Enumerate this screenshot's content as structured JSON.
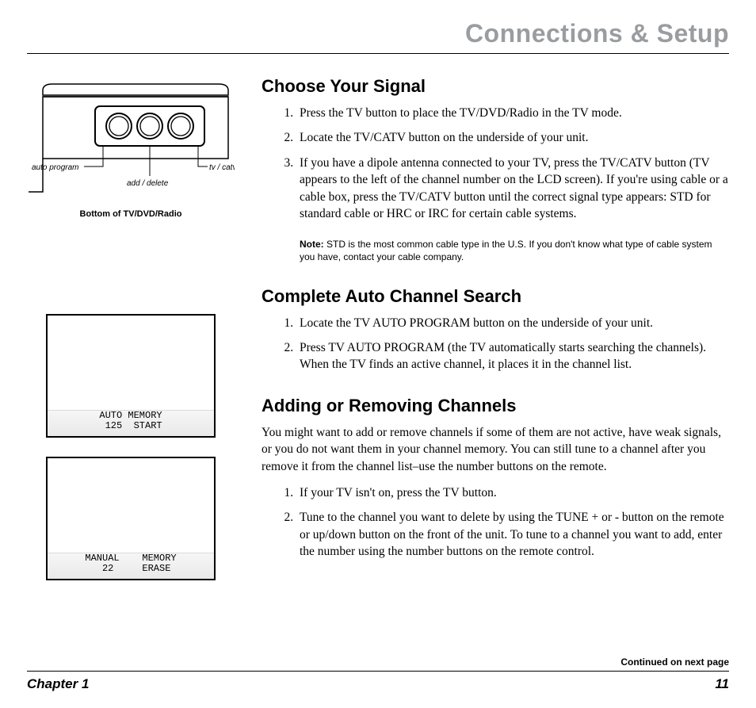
{
  "header": {
    "title": "Connections & Setup"
  },
  "diagram": {
    "label_auto_program": "auto program",
    "label_add_delete": "add / delete",
    "label_tv_catv": "tv / catv",
    "caption": "Bottom of TV/DVD/Radio"
  },
  "screens": {
    "auto": "AUTO MEMORY\n 125  START",
    "manual": "MANUAL    MEMORY\n  22     ERASE"
  },
  "sections": {
    "choose_signal": {
      "title": "Choose Your Signal",
      "steps": [
        "Press the TV button to place the TV/DVD/Radio in the TV mode.",
        "Locate the TV/CATV button on the underside of your unit.",
        "If you have a dipole antenna connected to your TV, press the TV/CATV button (TV appears to the left of the channel number on the LCD screen). If you're using cable or a cable box, press the TV/CATV button until the correct signal type appears: STD for standard cable or HRC or IRC for certain cable systems."
      ],
      "note_label": "Note:",
      "note_text": " STD is the most common cable type in the U.S. If you don't know what type of cable system you have, contact your cable company."
    },
    "auto_search": {
      "title": "Complete Auto Channel Search",
      "steps": [
        "Locate the TV AUTO PROGRAM button on the underside of your unit.",
        "Press TV AUTO PROGRAM (the TV automatically starts searching the channels). When the TV finds an active channel, it places it in the channel list."
      ]
    },
    "add_remove": {
      "title": "Adding or Removing Channels",
      "intro": "You might want to add or remove channels if some of them are not active, have weak signals, or you do not want them in your channel memory. You can still tune to a channel after you remove it from the channel list–use the number buttons on the remote.",
      "steps": [
        "If your TV isn't on, press the TV button.",
        "Tune to the channel you want to delete by using the TUNE + or - button on the remote or up/down button on the front of the unit. To tune to a channel you want to add, enter the number using the number buttons on the remote control."
      ]
    }
  },
  "footer": {
    "continued": "Continued on next page",
    "chapter": "Chapter 1",
    "page": "11"
  }
}
